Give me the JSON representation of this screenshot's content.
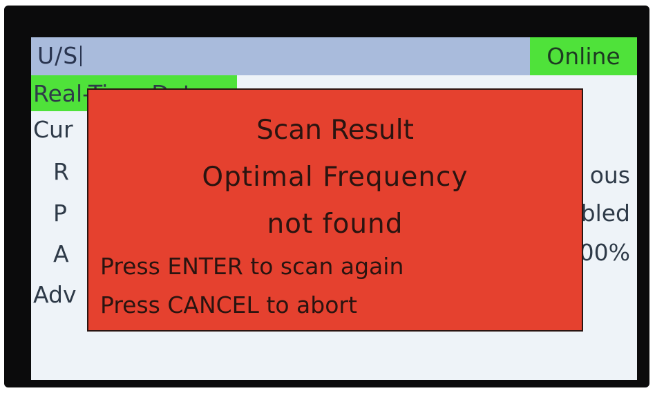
{
  "header": {
    "title": "U/S",
    "status": "Online"
  },
  "menu": {
    "items": [
      {
        "label": "Real-Time Data"
      },
      {
        "label": "Cur"
      },
      {
        "label": "R"
      },
      {
        "label": "P"
      },
      {
        "label": "A"
      },
      {
        "label": "Adv"
      }
    ],
    "values": [
      {
        "text": "ous"
      },
      {
        "text": "bled"
      },
      {
        "text": "00%"
      }
    ]
  },
  "dialog": {
    "title": "Scan Result",
    "line1": "Optimal Frequency",
    "line2": "not found",
    "enter_instruction": "Press ENTER to scan again",
    "cancel_instruction": "Press CANCEL to abort"
  },
  "colors": {
    "screen_bg": "#eef3f8",
    "title_bar": "#a9bbdc",
    "status_green": "#4fe23a",
    "highlight_green": "#4fe23a",
    "dialog_red": "#e5412f",
    "bezel": "#0b0b0c"
  }
}
